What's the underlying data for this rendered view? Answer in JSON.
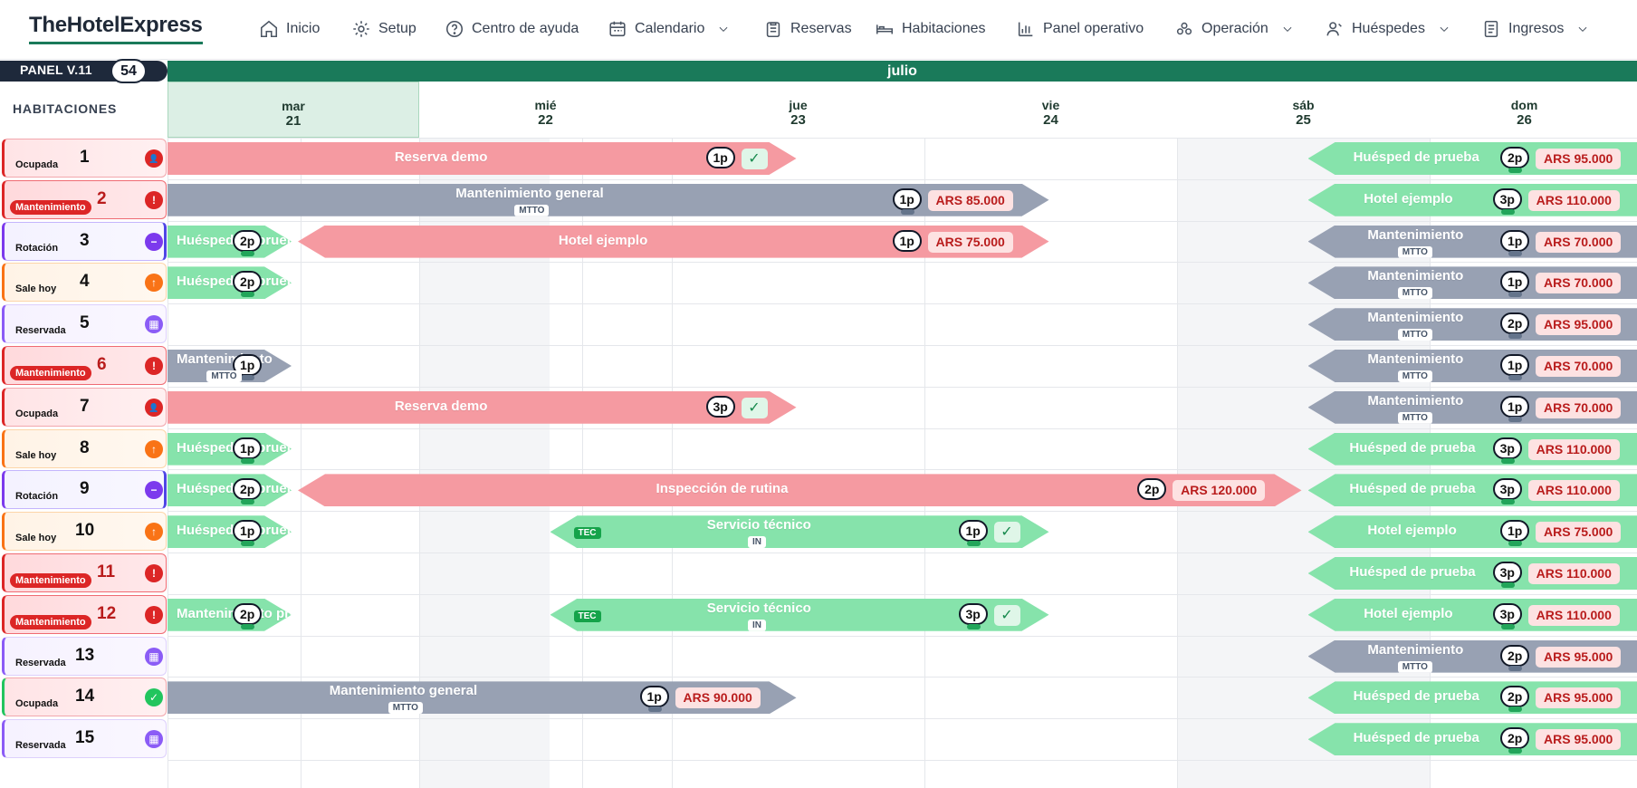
{
  "brand": "TheHotelExpress",
  "nav": [
    {
      "label": "Inicio",
      "icon": "home-icon"
    },
    {
      "label": "Setup",
      "icon": "gear-icon"
    },
    {
      "label": "Centro de ayuda",
      "icon": "help-circle-icon"
    },
    {
      "label": "Calendario",
      "icon": "calendar-icon",
      "dropdown": true
    },
    {
      "label": "Reservas",
      "icon": "clipboard-icon"
    },
    {
      "label": "Habitaciones",
      "icon": "bed-icon"
    },
    {
      "label": "Panel operativo",
      "icon": "bar-chart-icon"
    },
    {
      "label": "Operación",
      "icon": "users-circle-icon",
      "dropdown": true
    },
    {
      "label": "Huéspedes",
      "icon": "user-icon",
      "dropdown": true
    },
    {
      "label": "Ingresos",
      "icon": "document-icon",
      "dropdown": true
    }
  ],
  "panel": {
    "label": "PANEL V.11",
    "count": "54"
  },
  "month": "julio",
  "rooms_title": "HABITACIONES",
  "days": [
    {
      "name": "mar",
      "num": "21"
    },
    {
      "name": "mié",
      "num": "22"
    },
    {
      "name": "jue",
      "num": "23"
    },
    {
      "name": "vie",
      "num": "24"
    },
    {
      "name": "sáb",
      "num": "25"
    },
    {
      "name": "dom",
      "num": "26"
    }
  ],
  "colors": {
    "brand": "#1a7a5a",
    "reservation": "#f59aa1",
    "maintenance": "#98a1b3",
    "guest": "#7fe0a4",
    "ocupada": "#dc2626",
    "mantenimiento": "#dc2626",
    "rotacion": "#6d28d9",
    "sale_hoy": "#f97316",
    "reservada": "#8b5cf6"
  },
  "rooms": [
    {
      "number": "1",
      "status": "Ocupada",
      "kind": "ocupada"
    },
    {
      "number": "2",
      "status": "Mantenimiento",
      "kind": "mantenimiento"
    },
    {
      "number": "3",
      "status": "Rotación",
      "kind": "rotacion"
    },
    {
      "number": "4",
      "status": "Sale hoy",
      "kind": "salehoy"
    },
    {
      "number": "5",
      "status": "Reservada",
      "kind": "reservada"
    },
    {
      "number": "6",
      "status": "Mantenimiento",
      "kind": "mantenimiento"
    },
    {
      "number": "7",
      "status": "Ocupada",
      "kind": "ocupada"
    },
    {
      "number": "8",
      "status": "Sale hoy",
      "kind": "salehoy"
    },
    {
      "number": "9",
      "status": "Rotación",
      "kind": "rotacion"
    },
    {
      "number": "10",
      "status": "Sale hoy",
      "kind": "salehoy"
    },
    {
      "number": "11",
      "status": "Mantenimiento",
      "kind": "mantenimiento"
    },
    {
      "number": "12",
      "status": "Mantenimiento",
      "kind": "mantenimiento"
    },
    {
      "number": "13",
      "status": "Reservada",
      "kind": "reservada"
    },
    {
      "number": "14",
      "status": "Ocupada",
      "kind": "ocupada-ok"
    },
    {
      "number": "15",
      "status": "Reservada",
      "kind": "reservada"
    }
  ],
  "bookings": [
    {
      "room": 0,
      "type": "res",
      "start": 0,
      "end": 2.5,
      "title": "Reserva demo",
      "pax": "1p",
      "check": "✓"
    },
    {
      "room": 0,
      "type": "guest",
      "start": 4.5,
      "end": 6,
      "title": "Huésped de prueba",
      "pax": "2p",
      "price": "ARS 95.000"
    },
    {
      "room": 1,
      "type": "mtto",
      "start": 0,
      "end": 3.5,
      "title": "Mantenimiento general",
      "pax": "1p",
      "price": "ARS 85.000",
      "tag": "MTTO"
    },
    {
      "room": 1,
      "type": "guest",
      "start": 4.5,
      "end": 6,
      "title": "Hotel ejemplo",
      "pax": "3p",
      "price": "ARS 110.000"
    },
    {
      "room": 2,
      "type": "guest",
      "start": 0,
      "end": 0.5,
      "title": "Huésped de prueba",
      "pax": "2p"
    },
    {
      "room": 2,
      "type": "res",
      "start": 0.5,
      "end": 3.5,
      "title": "Hotel ejemplo",
      "pax": "1p",
      "price": "ARS 75.000"
    },
    {
      "room": 2,
      "type": "mtto",
      "start": 4.5,
      "end": 6,
      "title": "Mantenimiento",
      "pax": "1p",
      "price": "ARS 70.000",
      "tag": "MTTO"
    },
    {
      "room": 3,
      "type": "guest",
      "start": 0,
      "end": 0.5,
      "title": "Huésped de prueba",
      "pax": "2p"
    },
    {
      "room": 3,
      "type": "mtto",
      "start": 4.5,
      "end": 6,
      "title": "Mantenimiento",
      "pax": "1p",
      "price": "ARS 70.000",
      "tag": "MTTO"
    },
    {
      "room": 4,
      "type": "mtto",
      "start": 4.5,
      "end": 6,
      "title": "Mantenimiento",
      "pax": "2p",
      "price": "ARS 95.000",
      "tag": "MTTO"
    },
    {
      "room": 5,
      "type": "mtto",
      "start": 0,
      "end": 0.5,
      "title": "Mantenimiento",
      "pax": "1p",
      "tag": "MTTO"
    },
    {
      "room": 5,
      "type": "mtto",
      "start": 4.5,
      "end": 6,
      "title": "Mantenimiento",
      "pax": "1p",
      "price": "ARS 70.000",
      "tag": "MTTO"
    },
    {
      "room": 6,
      "type": "res",
      "start": 0,
      "end": 2.5,
      "title": "Reserva demo",
      "pax": "3p",
      "check": "✓"
    },
    {
      "room": 6,
      "type": "mtto",
      "start": 4.5,
      "end": 6,
      "title": "Mantenimiento",
      "pax": "1p",
      "price": "ARS 70.000",
      "tag": "MTTO"
    },
    {
      "room": 7,
      "type": "guest",
      "start": 0,
      "end": 0.5,
      "title": "Huésped de prueba",
      "pax": "1p"
    },
    {
      "room": 7,
      "type": "guest",
      "start": 4.5,
      "end": 6,
      "title": "Huésped de prueba",
      "pax": "3p",
      "price": "ARS 110.000"
    },
    {
      "room": 8,
      "type": "guest",
      "start": 0,
      "end": 0.5,
      "title": "Huésped de prueba",
      "pax": "2p"
    },
    {
      "room": 8,
      "type": "res",
      "start": 0.5,
      "end": 4.5,
      "title": "Inspección de rutina",
      "pax": "2p",
      "price": "ARS 120.000"
    },
    {
      "room": 8,
      "type": "guest",
      "start": 4.5,
      "end": 6,
      "title": "Huésped de prueba",
      "pax": "3p",
      "price": "ARS 110.000"
    },
    {
      "room": 9,
      "type": "guest",
      "start": 0,
      "end": 0.5,
      "title": "Huésped de prueba",
      "pax": "1p"
    },
    {
      "room": 9,
      "type": "guest",
      "start": 1.5,
      "end": 3.5,
      "title": "Servicio técnico",
      "pax": "1p",
      "check": "✓",
      "tec": "TEC",
      "tag": "IN"
    },
    {
      "room": 9,
      "type": "guest",
      "start": 4.5,
      "end": 6,
      "title": "Hotel ejemplo",
      "pax": "1p",
      "price": "ARS 75.000"
    },
    {
      "room": 10,
      "type": "guest",
      "start": 4.5,
      "end": 6,
      "title": "Huésped de prueba",
      "pax": "3p",
      "price": "ARS 110.000"
    },
    {
      "room": 11,
      "type": "guest",
      "start": 0,
      "end": 0.5,
      "title": "Mantenimiento preventivo",
      "pax": "2p"
    },
    {
      "room": 11,
      "type": "guest",
      "start": 1.5,
      "end": 3.5,
      "title": "Servicio técnico",
      "pax": "3p",
      "check": "✓",
      "tec": "TEC",
      "tag": "IN"
    },
    {
      "room": 11,
      "type": "guest",
      "start": 4.5,
      "end": 6,
      "title": "Hotel ejemplo",
      "pax": "3p",
      "price": "ARS 110.000"
    },
    {
      "room": 12,
      "type": "mtto",
      "start": 4.5,
      "end": 6,
      "title": "Mantenimiento",
      "pax": "2p",
      "price": "ARS 95.000",
      "tag": "MTTO"
    },
    {
      "room": 13,
      "type": "mtto",
      "start": 0,
      "end": 2.5,
      "title": "Mantenimiento general",
      "pax": "1p",
      "price": "ARS 90.000",
      "tag": "MTTO"
    },
    {
      "room": 13,
      "type": "guest",
      "start": 4.5,
      "end": 6,
      "title": "Huésped de prueba",
      "pax": "2p",
      "price": "ARS 95.000"
    },
    {
      "room": 14,
      "type": "guest",
      "start": 4.5,
      "end": 6,
      "title": "Huésped de prueba",
      "pax": "2p",
      "price": "ARS 95.000"
    }
  ]
}
